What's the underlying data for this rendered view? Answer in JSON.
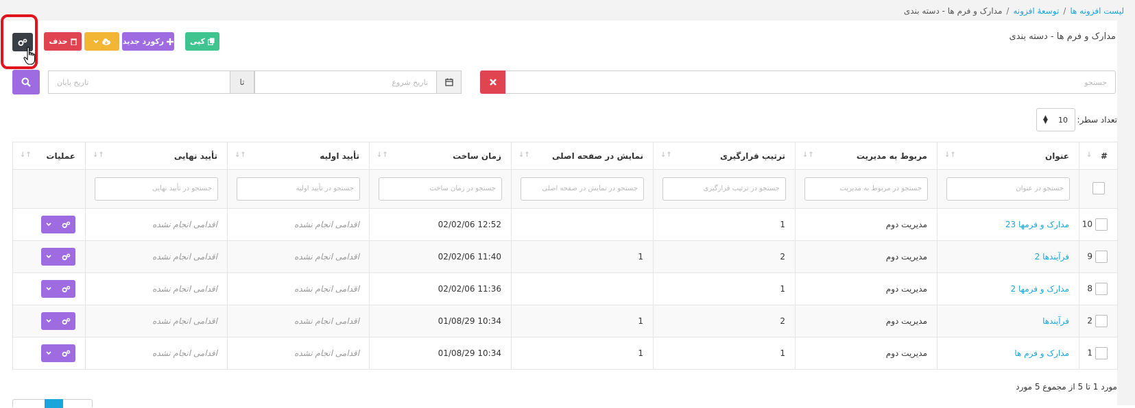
{
  "breadcrumb": {
    "items": [
      "لیست افزونه ها",
      "توسعهٔ افزونه"
    ],
    "separator": "/",
    "current": "مدارک و فرم ها - دسته بندی"
  },
  "page": {
    "title": "مدارک و فرم ها - دسته بندی"
  },
  "toolbar": {
    "copy_label": "کپی",
    "new_label": "رکورد جدید",
    "delete_label": "حذف"
  },
  "search": {
    "placeholder": "جستجو",
    "start_date_placeholder": "تاریخ شروع",
    "to_label": "تا",
    "end_date_placeholder": "تاریخ پایان"
  },
  "rows_per_page": {
    "label": "تعداد سطر:",
    "value": "10"
  },
  "table": {
    "headers": {
      "id": "#",
      "title": "عنوان",
      "related": "مربوط به مدیریت",
      "order": "ترتیب قرارگیری",
      "home": "نمایش در صفحه اصلی",
      "created": "زمان ساخت",
      "approve1": "تأیید اولیه",
      "approve2": "تأیید نهایی",
      "ops": "عملیات"
    },
    "filters": {
      "title": "جستجو در عنوان",
      "related": "جستجو در مربوط به مدیریت",
      "order": "جستجو در ترتیب قرارگیری",
      "home": "جستجو در نمایش در صفحه اصلی",
      "created": "جستجو در زمان ساخت",
      "approve1": "جستجو در تأیید اولیه",
      "approve2": "جستجو در تأیید نهایی"
    },
    "rows": [
      {
        "id": "10",
        "title": "مدارک و فرمها 23",
        "related": "مدیریت دوم",
        "order": "1",
        "home": "",
        "created": "12:52 02/02/06",
        "approve1": "اقدامی انجام نشده",
        "approve2": "اقدامی انجام نشده"
      },
      {
        "id": "9",
        "title": "فرآیندها 2",
        "related": "مدیریت دوم",
        "order": "2",
        "home": "1",
        "created": "11:40 02/02/06",
        "approve1": "اقدامی انجام نشده",
        "approve2": "اقدامی انجام نشده"
      },
      {
        "id": "8",
        "title": "مدارک و فرمها 2",
        "related": "مدیریت دوم",
        "order": "1",
        "home": "",
        "created": "11:36 02/02/06",
        "approve1": "اقدامی انجام نشده",
        "approve2": "اقدامی انجام نشده"
      },
      {
        "id": "2",
        "title": "فرآیندها",
        "related": "مدیریت دوم",
        "order": "2",
        "home": "1",
        "created": "10:34 01/08/29",
        "approve1": "اقدامی انجام نشده",
        "approve2": "اقدامی انجام نشده"
      },
      {
        "id": "1",
        "title": "مدارک و فرم ها",
        "related": "مدیریت دوم",
        "order": "1",
        "home": "1",
        "created": "10:34 01/08/29",
        "approve1": "اقدامی انجام نشده",
        "approve2": "اقدامی انجام نشده"
      }
    ]
  },
  "summary": "مورد 1 تا 5 از مجموع 5 مورد",
  "colors": {
    "primary_purple": "#9e6be0",
    "danger": "#e04450",
    "warning": "#f2b534",
    "success": "#3fc48f",
    "link": "#1aa6d8",
    "highlight": "#e1131f"
  },
  "icons": [
    "cogs-icon",
    "trash-icon",
    "cloud-download-icon",
    "chevron-down-icon",
    "plus-icon",
    "copy-icon",
    "times-icon",
    "calendar-icon",
    "search-icon",
    "sort-icon",
    "hand-pointer-icon"
  ]
}
